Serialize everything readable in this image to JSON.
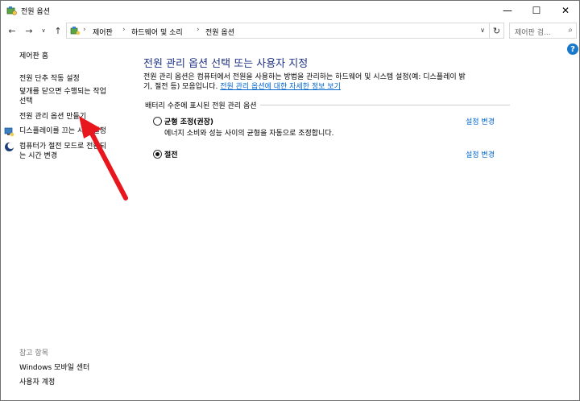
{
  "window": {
    "title": "전원 옵션",
    "minimize": "—",
    "maximize": "☐",
    "close": "✕"
  },
  "address": {
    "crumbs": [
      "제어판",
      "하드웨어 및 소리",
      "전원 옵션"
    ],
    "separator": "›",
    "search_placeholder": "제어판 검..."
  },
  "nav": {
    "back": "←",
    "forward": "→",
    "history": "∨",
    "up": "↑",
    "dropdown": "∨",
    "refresh": "↻",
    "search_icon": "⌕"
  },
  "help": "?",
  "sidebar": {
    "home": "제어판 홈",
    "items": [
      "전원 단추 작동 설정",
      "덮개를 닫으면 수행되는 작업",
      "선택",
      "전원 관리 옵션 만들기",
      "디스플레이를 끄는 시간 설정",
      "컴퓨터가 절전 모드로 전환되",
      "는 시간 변경"
    ],
    "see_also": "참고 항목",
    "see_also_items": [
      "Windows 모바일 센터",
      "사용자 계정"
    ]
  },
  "main": {
    "title": "전원 관리 옵션 선택 또는 사용자 지정",
    "desc_1": "전원 관리 옵션은 컴퓨터에서 전원을 사용하는 방법을 관리하는 하드웨어 및 시스템 설정(예: 디스플레이 밝",
    "desc_2": "기, 절전 등) 모음입니다. ",
    "desc_link": "전원 관리 옵션에 대한 자세한 정보 보기",
    "group_header": "배터리 수준에 표시된 전원 관리 옵션",
    "plans": [
      {
        "name": "균형 조정(권장)",
        "desc": "에너지 소비와 성능 사이의 균형을 자동으로 조정합니다.",
        "link": "설정 변경",
        "selected": false
      },
      {
        "name": "절전",
        "link": "설정 변경",
        "selected": true
      }
    ]
  },
  "colors": {
    "title_blue": "#1e3287",
    "link_blue": "#0066cc",
    "arrow_red": "#e8161d"
  },
  "icons": {
    "app": "power-options-icon",
    "address": "control-panel-icon",
    "display": "display-icon",
    "sleep": "moon-icon"
  }
}
